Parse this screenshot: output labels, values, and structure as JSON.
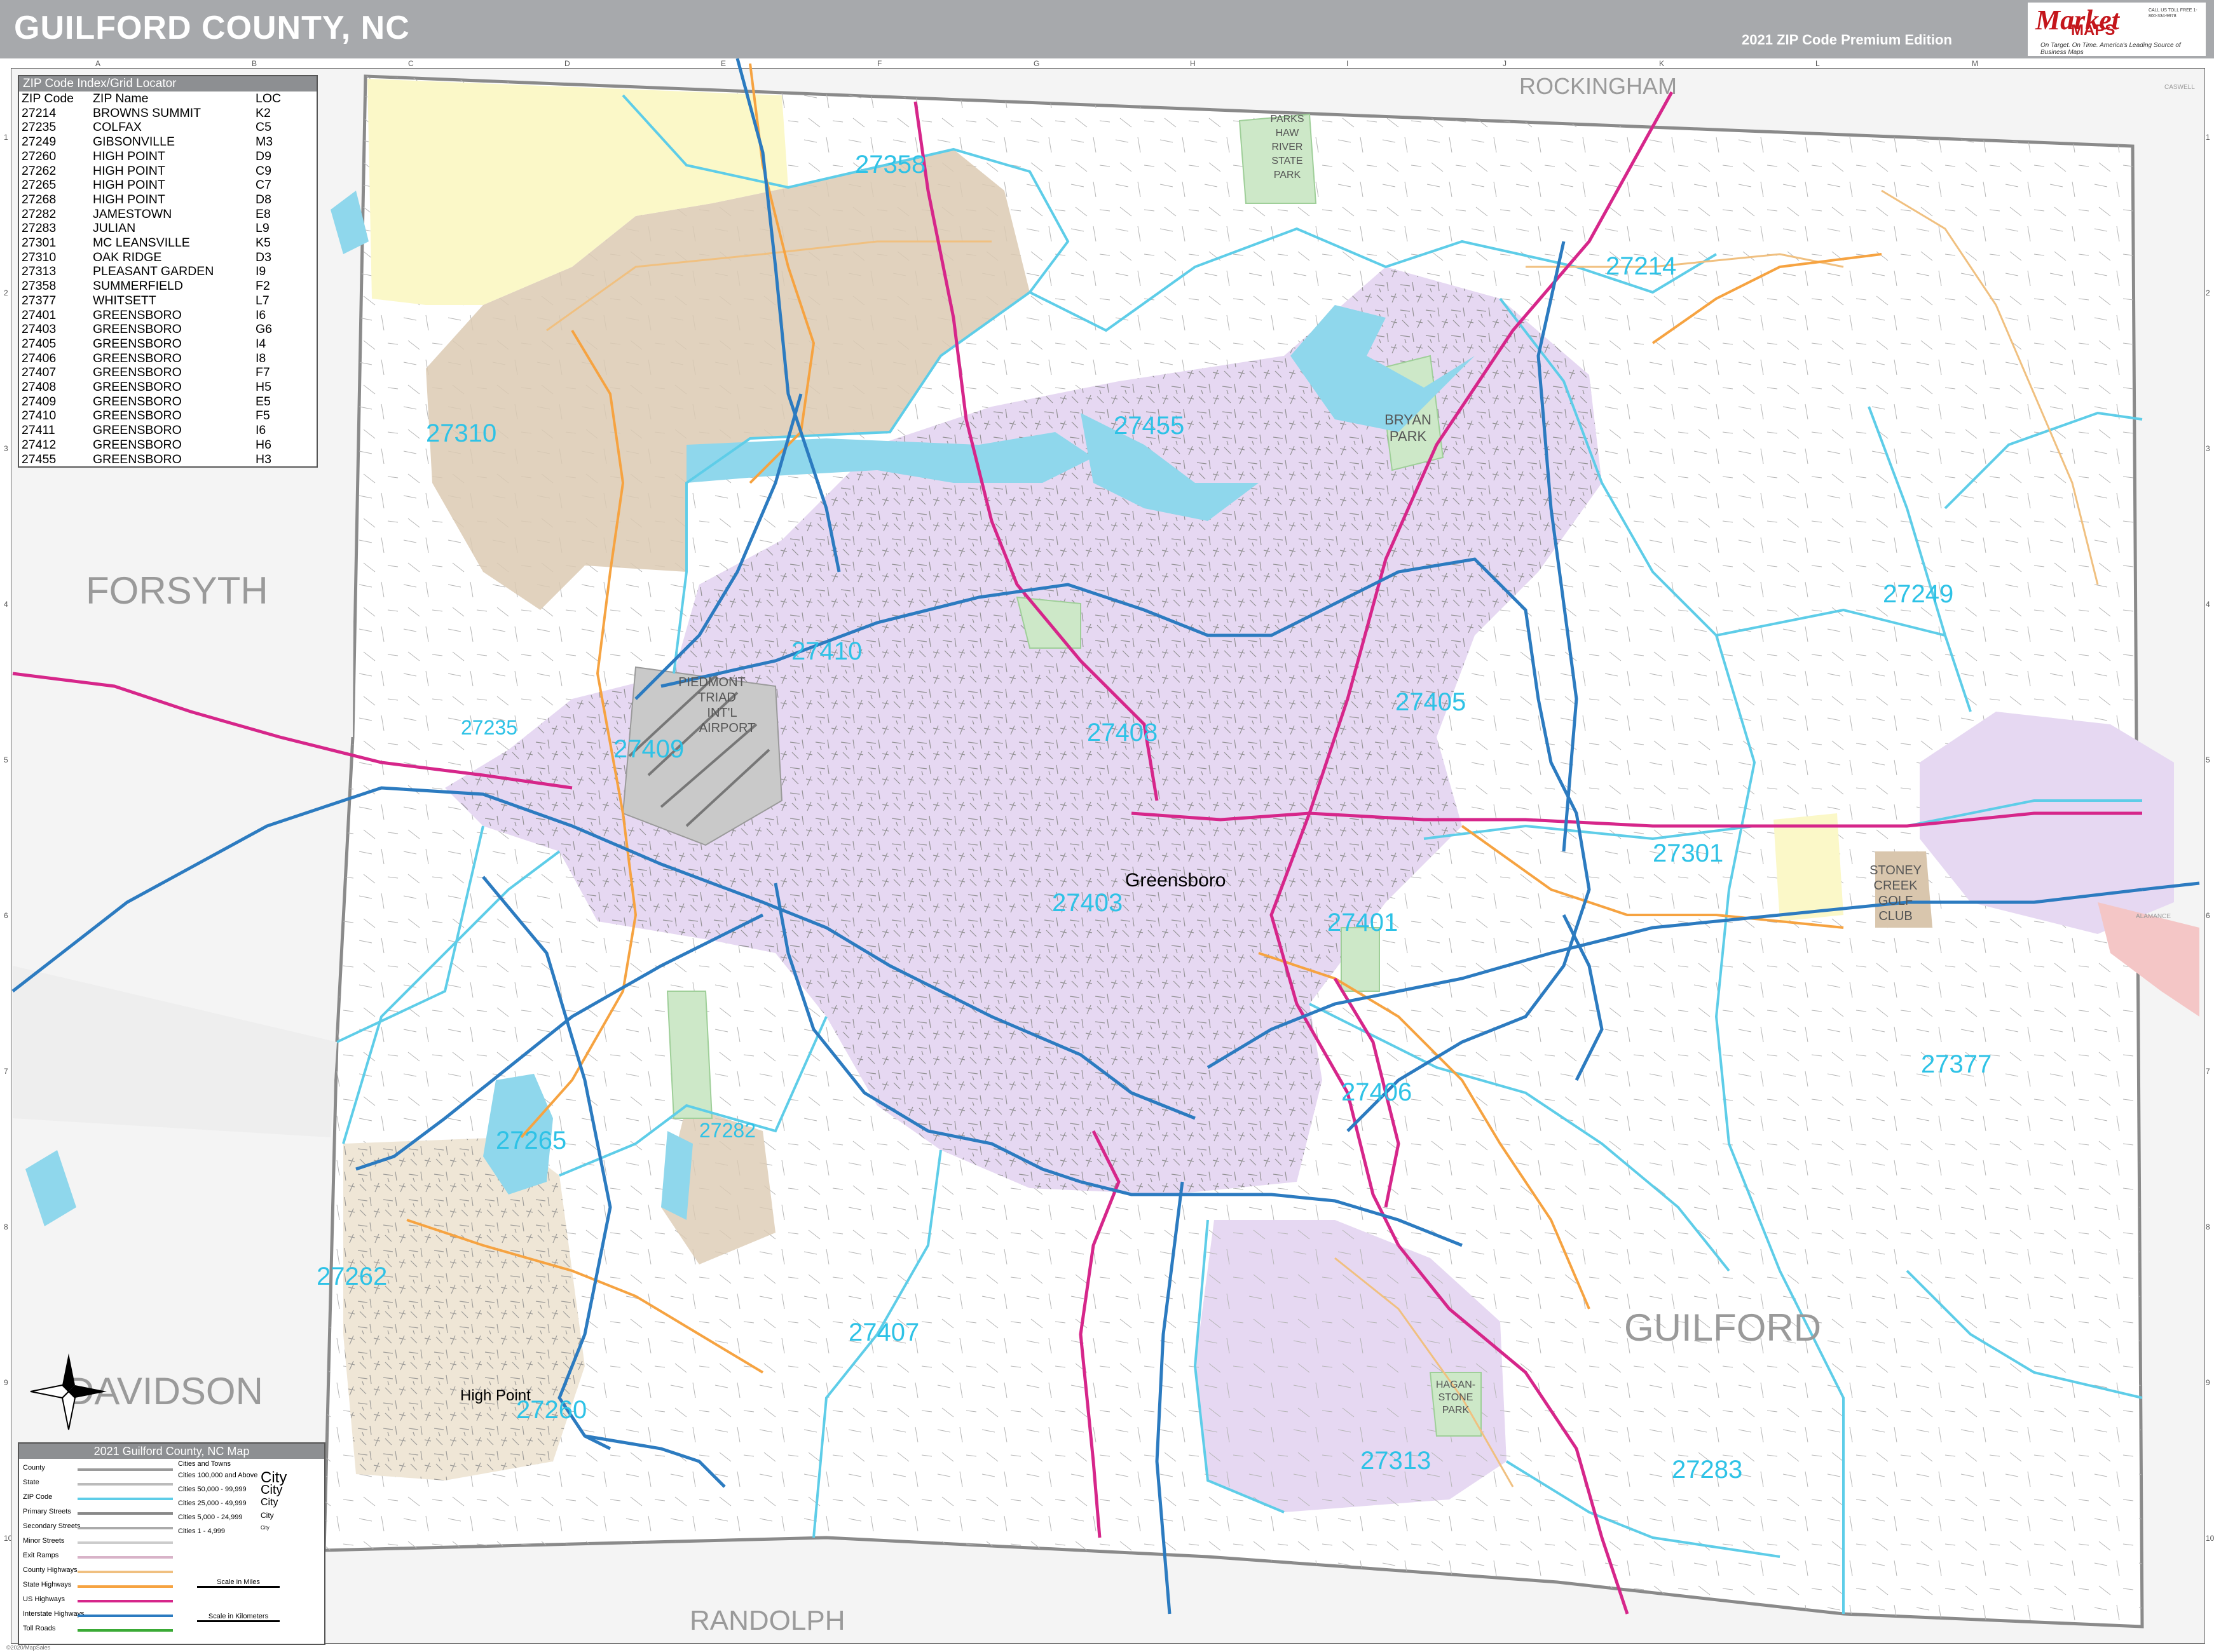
{
  "header": {
    "title": "GUILFORD COUNTY, NC",
    "edition": "2021 ZIP Code Premium Edition"
  },
  "logo": {
    "market": "Market",
    "maps": "MAPS",
    "tagline": "On Target. On Time.",
    "tagline2": "America's Leading Source of Business Maps",
    "contact": "CALL US TOLL FREE 1-800-334-9978"
  },
  "zip_index": {
    "title": "ZIP Code Index/Grid Locator",
    "columns": [
      "ZIP Code",
      "ZIP Name",
      "LOC"
    ],
    "rows": [
      [
        "27214",
        "BROWNS SUMMIT",
        "K2"
      ],
      [
        "27235",
        "COLFAX",
        "C5"
      ],
      [
        "27249",
        "GIBSONVILLE",
        "M3"
      ],
      [
        "27260",
        "HIGH POINT",
        "D9"
      ],
      [
        "27262",
        "HIGH POINT",
        "C9"
      ],
      [
        "27265",
        "HIGH POINT",
        "C7"
      ],
      [
        "27268",
        "HIGH POINT",
        "D8"
      ],
      [
        "27282",
        "JAMESTOWN",
        "E8"
      ],
      [
        "27283",
        "JULIAN",
        "L9"
      ],
      [
        "27301",
        "MC LEANSVILLE",
        "K5"
      ],
      [
        "27310",
        "OAK RIDGE",
        "D3"
      ],
      [
        "27313",
        "PLEASANT GARDEN",
        "I9"
      ],
      [
        "27358",
        "SUMMERFIELD",
        "F2"
      ],
      [
        "27377",
        "WHITSETT",
        "L7"
      ],
      [
        "27401",
        "GREENSBORO",
        "I6"
      ],
      [
        "27403",
        "GREENSBORO",
        "G6"
      ],
      [
        "27405",
        "GREENSBORO",
        "I4"
      ],
      [
        "27406",
        "GREENSBORO",
        "I8"
      ],
      [
        "27407",
        "GREENSBORO",
        "F7"
      ],
      [
        "27408",
        "GREENSBORO",
        "H5"
      ],
      [
        "27409",
        "GREENSBORO",
        "E5"
      ],
      [
        "27410",
        "GREENSBORO",
        "F5"
      ],
      [
        "27411",
        "GREENSBORO",
        "I6"
      ],
      [
        "27412",
        "GREENSBORO",
        "H6"
      ],
      [
        "27455",
        "GREENSBORO",
        "H3"
      ]
    ]
  },
  "counties": {
    "rockingham": "ROCKINGHAM",
    "forsyth": "FORSYTH",
    "davidson": "DAVIDSON",
    "randolph": "RANDOLPH",
    "guilford": "GUILFORD",
    "alamance": "ALAMANCE",
    "caswell": "CASWELL"
  },
  "zip_labels": {
    "z27358": "27358",
    "z27214": "27214",
    "z27455": "27455",
    "z27310": "27310",
    "z27249": "27249",
    "z27410": "27410",
    "z27405": "27405",
    "z27235": "27235",
    "z27409": "27409",
    "z27408": "27408",
    "z27301": "27301",
    "z27403": "27403",
    "z27401": "27401",
    "z27377": "27377",
    "z27406": "27406",
    "z27265": "27265",
    "z27282": "27282",
    "z27262": "27262",
    "z27407": "27407",
    "z27260": "27260",
    "z27313": "27313",
    "z27283": "27283"
  },
  "places": {
    "greensboro": "Greensboro",
    "high_point": "High Point",
    "airport_l1": "PIEDMONT",
    "airport_l2": "TRIAD",
    "airport_l3": "INT'L",
    "airport_l4": "AIRPORT",
    "haw_l1": "PARKS",
    "haw_l2": "HAW",
    "haw_l3": "RIVER",
    "haw_l4": "STATE",
    "haw_l5": "PARK",
    "bryan_l1": "BRYAN",
    "bryan_l2": "PARK",
    "stoney_l1": "STONEY",
    "stoney_l2": "CREEK",
    "stoney_l3": "GOLF",
    "stoney_l4": "CLUB",
    "hagan_l1": "HAGAN-",
    "hagan_l2": "STONE",
    "hagan_l3": "PARK"
  },
  "grid": {
    "letters": [
      "A",
      "B",
      "C",
      "D",
      "E",
      "F",
      "G",
      "H",
      "I",
      "J",
      "K",
      "L",
      "M"
    ],
    "numbers": [
      "1",
      "2",
      "3",
      "4",
      "5",
      "6",
      "7",
      "8",
      "9",
      "10"
    ]
  },
  "legend": {
    "title": "2021 Guilford County, NC Map",
    "types": [
      "County",
      "State",
      "ZIP Code",
      "Primary Streets",
      "Secondary Streets",
      "Minor Streets",
      "Exit Ramps",
      "County Highways",
      "State Highways",
      "US Highways",
      "Interstate Highways",
      "Toll Roads"
    ],
    "cities_header": "Cities and Towns",
    "city_sizes": [
      "Cities 100,000 and Above",
      "Cities 50,000 - 99,999",
      "Cities 25,000 - 49,999",
      "Cities 5,000 - 24,999",
      "Cities 1 - 4,999"
    ],
    "city_samples": [
      "City",
      "City",
      "City",
      "City",
      "City"
    ],
    "scale_miles": "Scale in Miles",
    "scale_km": "Scale in Kilometers",
    "colors": {
      "county": "#9a9a9a",
      "state": "#bbbbbb",
      "zip": "#5ecde8",
      "primary": "#888888",
      "secondary": "#aaaaaa",
      "minor": "#cccccc",
      "ramps": "#d8b3c8",
      "county_hwy": "#f0c080",
      "state_hwy": "#f6a341",
      "us_hwy": "#d6268a",
      "interstate": "#2c7bc0",
      "toll": "#3aaa35"
    }
  },
  "copyright": "©2020/MapSales",
  "colors": {
    "greensboro_fill": "#e4d6f2",
    "summerfield_fill": "#d9c6ad",
    "gibsonville_fill": "#fbf7c6",
    "highpoint_fill": "#efe6d6",
    "water": "#8fd7ec",
    "park": "#cde8c8",
    "interstate": "#2c7bc0",
    "us_hwy": "#d6268a",
    "state_hwy": "#f6a341",
    "zip_boundary": "#5ecde8",
    "zip_label": "#2ec2e6",
    "county_label": "#9a9a9a"
  }
}
